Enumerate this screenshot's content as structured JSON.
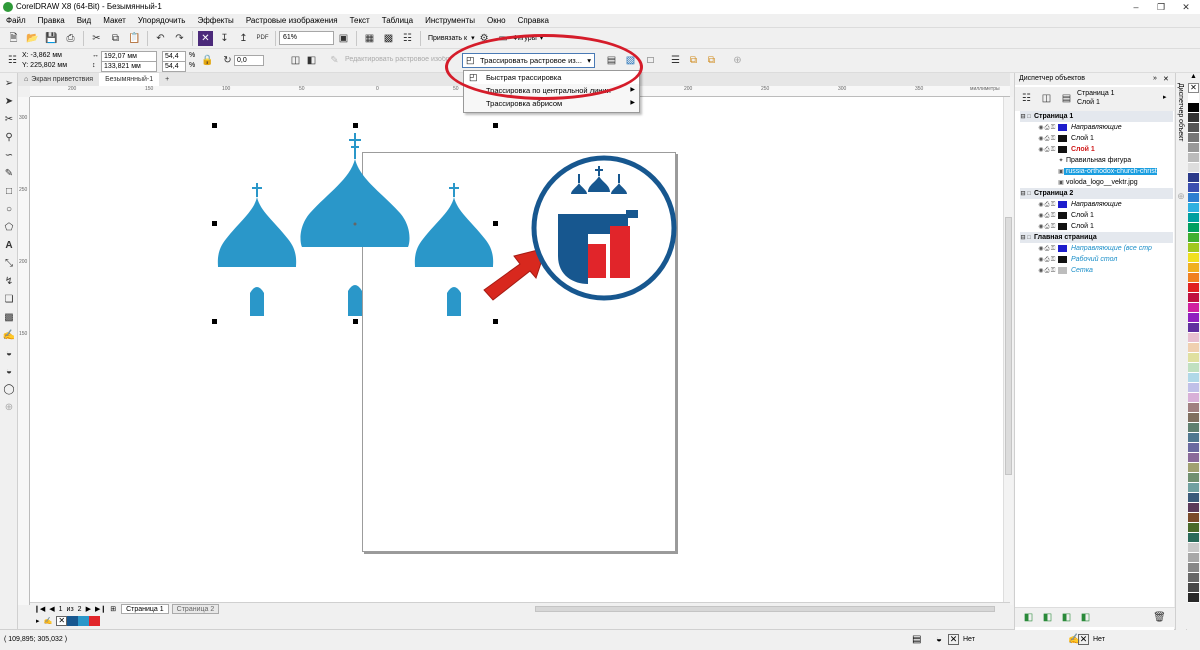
{
  "app": {
    "title": "CorelDRAW X8 (64-Bit) - Безымянный-1"
  },
  "menu": [
    "Файл",
    "Правка",
    "Вид",
    "Макет",
    "Упорядочить",
    "Эффекты",
    "Растровые изображения",
    "Текст",
    "Таблица",
    "Инструменты",
    "Окно",
    "Справка"
  ],
  "toolbar": {
    "zoom": "61%",
    "snap_label": "Привязать к",
    "shapes_label": "Фигуры"
  },
  "props": {
    "x": "X: -3,862 мм",
    "y": "Y: 225,802 мм",
    "w": "192,07 мм",
    "h": "133,821 мм",
    "sx": "54,4",
    "sy": "54,4",
    "pct": "%",
    "angle": "0,0",
    "edit_bitmap": "Редактировать растровое изображение",
    "trace_button": "Трассировать растровое из..."
  },
  "trace_menu": {
    "items": [
      "Быстрая трассировка",
      "Трассировка по центральной линии",
      "Трассировка абрисом"
    ]
  },
  "doc_tabs": [
    "Экран приветствия",
    "Безымянный-1"
  ],
  "ruler": {
    "h_labels": [
      "200",
      "150",
      "100",
      "50",
      "0",
      "50",
      "100",
      "150",
      "200",
      "250",
      "300",
      "350"
    ],
    "unit": "миллиметры",
    "v_labels": [
      "300",
      "250",
      "200",
      "150"
    ]
  },
  "page_nav": {
    "current": "1",
    "of": "из",
    "total": "2",
    "tabs": [
      "Страница 1",
      "Страница 2"
    ]
  },
  "status": {
    "coords": "( 109,895; 305,032 )",
    "fill_none": "Нет",
    "outline_none": "Нет"
  },
  "objmgr": {
    "title": "Диспетчер объектов",
    "current_page": "Страница 1",
    "current_layer": "Слой 1",
    "tree": [
      {
        "label": "Страница 1",
        "kind": "page"
      },
      {
        "label": "Направляющие",
        "kind": "layer",
        "color": "#1d1dcc",
        "italic": true
      },
      {
        "label": "Слой 1",
        "kind": "layer",
        "color": "#111111"
      },
      {
        "label": "Слой 1",
        "kind": "layer-active",
        "color": "#111111"
      },
      {
        "label": "Правильная фигура",
        "kind": "object"
      },
      {
        "label": "russia-orthodox-church-christ",
        "kind": "object-selected"
      },
      {
        "label": "voloda_logo__vektr.jpg",
        "kind": "object"
      },
      {
        "label": "Страница 2",
        "kind": "page"
      },
      {
        "label": "Направляющие",
        "kind": "layer",
        "color": "#1d1dcc",
        "italic": true
      },
      {
        "label": "Слой 1",
        "kind": "layer",
        "color": "#111111"
      },
      {
        "label": "Слой 1",
        "kind": "layer",
        "color": "#111111"
      },
      {
        "label": "Главная страница",
        "kind": "page"
      },
      {
        "label": "Направляющие (все стр",
        "kind": "master",
        "color": "#1d1dcc"
      },
      {
        "label": "Рабочий стол",
        "kind": "master",
        "color": "#111111"
      },
      {
        "label": "Сетка",
        "kind": "master",
        "color": "#bdbdbd"
      }
    ],
    "docker_tab": "Диспетчер объект"
  },
  "palette": [
    "#ffffff",
    "#000000",
    "#333333",
    "#555555",
    "#777777",
    "#999999",
    "#bbbbbb",
    "#dddddd",
    "#2b3a8a",
    "#3c4fb0",
    "#2f7fd0",
    "#2fb0e0",
    "#00a0a0",
    "#00a060",
    "#40b030",
    "#a0c820",
    "#f0e020",
    "#f0b020",
    "#f08020",
    "#e02020",
    "#c01040",
    "#d020a0",
    "#9020c0",
    "#6030a0",
    "#e8c0d0",
    "#f0d0b0",
    "#e0e0a0",
    "#c0e0c0",
    "#b0d8e8",
    "#c0c0e8",
    "#d8b0d8",
    "#a08080",
    "#807060",
    "#608070",
    "#507890",
    "#6a6aa0",
    "#8a6a9a",
    "#a0a070",
    "#709070",
    "#70a0a0",
    "#3a5a7a",
    "#5a3a5a",
    "#7a4a2a",
    "#4a6a2a",
    "#2a6a5a",
    "#c8c8c8",
    "#a8a8a8",
    "#888888",
    "#686868",
    "#484848",
    "#282828"
  ]
}
